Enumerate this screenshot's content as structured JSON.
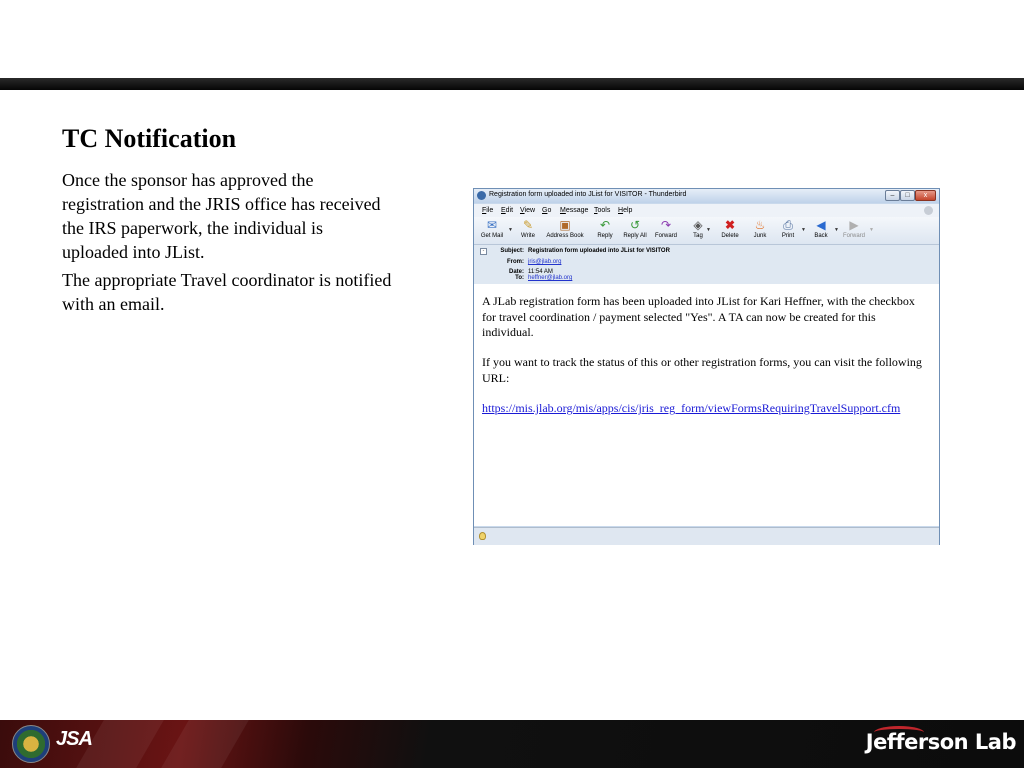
{
  "slide": {
    "title": "TC Notification",
    "paragraphs": [
      "Once the sponsor has approved the registration and the JRIS office has received the IRS paperwork, the individual is uploaded into JList.",
      "The appropriate Travel coordinator is notified with an email."
    ]
  },
  "window": {
    "title": "Registration form uploaded into JList for VISITOR - Thunderbird",
    "controls": {
      "minimize": "–",
      "maximize": "□",
      "close": "x"
    }
  },
  "menu": [
    {
      "key": "F",
      "rest": "ile"
    },
    {
      "key": "E",
      "rest": "dit"
    },
    {
      "key": "V",
      "rest": "iew"
    },
    {
      "key": "G",
      "rest": "o"
    },
    {
      "key": "M",
      "rest": "essage"
    },
    {
      "key": "T",
      "rest": "ools"
    },
    {
      "key": "H",
      "rest": "elp"
    }
  ],
  "toolbar": {
    "get_mail": "Get Mail",
    "write": "Write",
    "address_book": "Address Book",
    "reply": "Reply",
    "reply_all": "Reply All",
    "forward": "Forward",
    "tag": "Tag",
    "delete": "Delete",
    "junk": "Junk",
    "print": "Print",
    "back": "Back",
    "forward_nav": "Forward"
  },
  "icons": {
    "get_mail": "get-mail-icon",
    "write": "write-icon",
    "address_book": "address-book-icon",
    "reply": "reply-icon",
    "reply_all": "reply-all-icon",
    "forward": "forward-icon",
    "tag": "tag-icon",
    "delete": "delete-icon",
    "junk": "junk-icon",
    "print": "print-icon",
    "back": "back-icon",
    "forward_nav": "forward-nav-icon"
  },
  "header": {
    "subject_label": "Subject:",
    "subject": "Registration form uploaded into JList for VISITOR",
    "from_label": "From:",
    "from": "jris@jlab.org",
    "date_label": "Date:",
    "date": "11:54 AM",
    "to_label": "To:",
    "to": "heffner@jlab.org"
  },
  "body": {
    "para1": "A JLab registration form has been uploaded into JList for Kari Heffner, with the checkbox for travel coordination / payment selected \"Yes\". A TA can now be created for this individual.",
    "para2": "If you want to track the status of this or other registration forms, you can visit the following URL:",
    "url": "https://mis.jlab.org/mis/apps/cis/jris_reg_form/viewFormsRequiringTravelSupport.cfm"
  },
  "footer": {
    "jsa": "JSA",
    "jlab": "Jefferson Lab"
  },
  "colors": {
    "link": "#1a1ad6",
    "titlebar": "#bfd2ea",
    "footer_red": "#6a1414"
  }
}
